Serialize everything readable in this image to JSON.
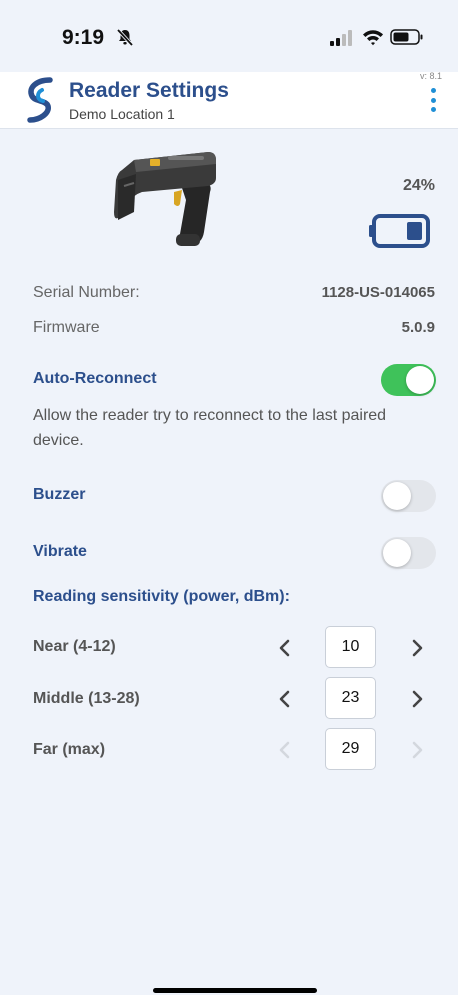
{
  "status": {
    "time": "9:19"
  },
  "header": {
    "title": "Reader Settings",
    "subtitle": "Demo Location 1",
    "version": "v: 8.1"
  },
  "device": {
    "battery_percent": "24%",
    "battery_level": 0.24,
    "serial_label": "Serial Number:",
    "serial_value": "1128-US-014065",
    "firmware_label": "Firmware",
    "firmware_value": "5.0.9"
  },
  "settings": {
    "auto_reconnect": {
      "label": "Auto-Reconnect",
      "description": "Allow the reader try to reconnect to the last paired device.",
      "enabled": true
    },
    "buzzer": {
      "label": "Buzzer",
      "enabled": false
    },
    "vibrate": {
      "label": "Vibrate",
      "enabled": false
    }
  },
  "sensitivity": {
    "title": "Reading sensitivity (power, dBm):",
    "rows": [
      {
        "label": "Near (4-12)",
        "value": "10",
        "enabled": true
      },
      {
        "label": "Middle (13-28)",
        "value": "23",
        "enabled": true
      },
      {
        "label": "Far (max)",
        "value": "29",
        "enabled": false
      }
    ]
  },
  "colors": {
    "accent": "#2c4f8c",
    "toggle_on": "#3fc25a",
    "toggle_off": "#e3e6eb",
    "menu": "#1f8fd6",
    "background": "#eff3fa"
  }
}
